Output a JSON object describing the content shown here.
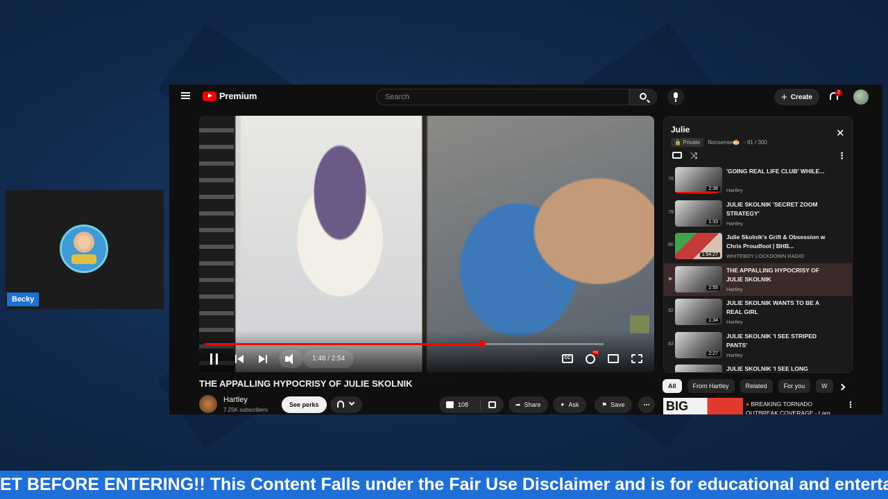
{
  "cam": {
    "name": "Becky"
  },
  "youtube": {
    "logo": "Premium",
    "search_placeholder": "Search",
    "create_label": "Create",
    "notification_count": "2",
    "player": {
      "progress": 0.695,
      "time": "1:48 / 2:54"
    },
    "video": {
      "title": "THE APPALLING HYPOCRISY OF JULIE SKOLNIK",
      "channel": "Hartley",
      "subscribers": "7.25K subscribers",
      "perks_label": "See perks",
      "likes": "108",
      "share_label": "Share",
      "ask_label": "Ask",
      "save_label": "Save"
    },
    "playlist": {
      "title": "Julie",
      "privacy": "Private",
      "owner": "Nonsense🍮",
      "position": "- 81 / 300",
      "items": [
        {
          "index": "78",
          "title": "'GOING REAL LIFE CLUB' WHILE...",
          "channel": "Hartley",
          "duration": "2:36",
          "progress": 0.9
        },
        {
          "index": "79",
          "title": "JULIE SKOLNIK 'SECRET ZOOM STRATEGY'",
          "channel": "Hartley",
          "duration": "1:33",
          "progress": 0
        },
        {
          "index": "80",
          "title": "Julie Skolnik's Grift & Obsession w Chris Proudfoot | BHB...",
          "channel": "WHITEBOY LOCKDOWN RADIO",
          "duration": "1:54:27",
          "progress": 0
        },
        {
          "index": "▶",
          "title": "THE APPALLING HYPOCRISY OF JULIE SKOLNIK",
          "channel": "Hartley",
          "duration": "2:55",
          "progress": 0
        },
        {
          "index": "82",
          "title": "JULIE SKOLNIK WANTS TO BE A REAL GIRL",
          "channel": "Hartley",
          "duration": "1:34",
          "progress": 0
        },
        {
          "index": "83",
          "title": "JULIE SKOLNIK 'I SEE STRIPED PANTS'",
          "channel": "Hartley",
          "duration": "2:27",
          "progress": 0
        },
        {
          "index": "84",
          "title": "JULIE SKOLNIK 'I SEE LONG BLACK PANTS AND A WHITE...",
          "channel": "Hartley",
          "duration": "",
          "progress": 0
        }
      ]
    },
    "chips": [
      "All",
      "From Hartley",
      "Related",
      "For you",
      "W"
    ],
    "recommendation": {
      "thumb_text": "BIG",
      "title": "BREAKING TORNADO OUTBREAK COVERAGE - Larg..."
    }
  },
  "ticker": "ET BEFORE ENTERING!! This Content Falls under the Fair Use Disclaimer and is for educational and entertainment"
}
